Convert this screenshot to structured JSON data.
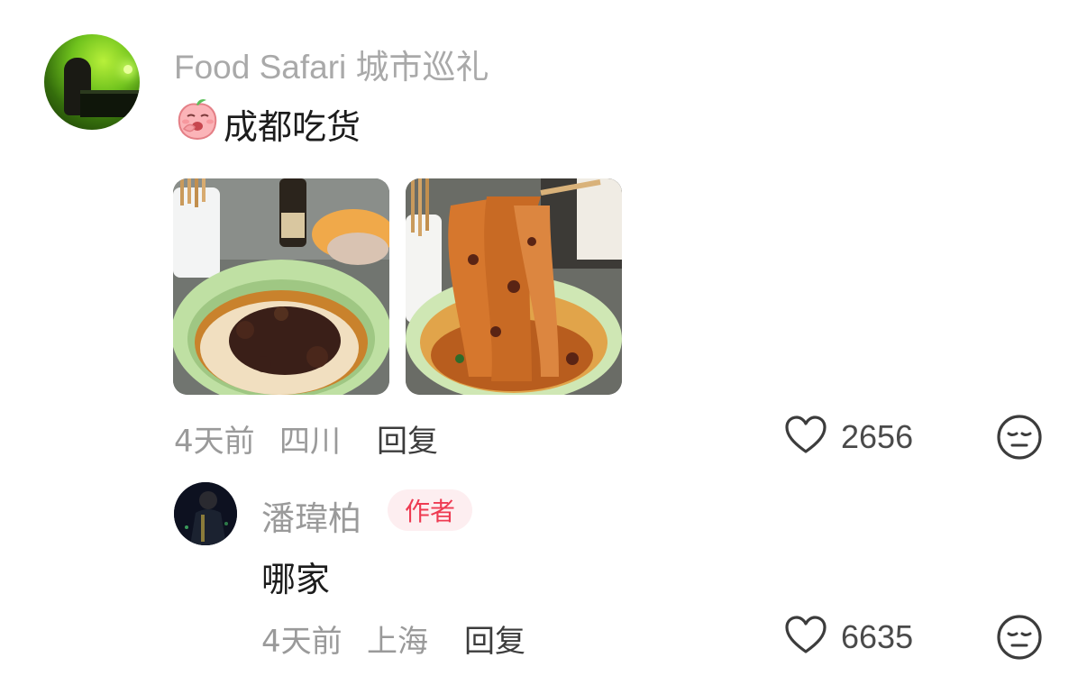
{
  "comment": {
    "username": "Food Safari 城市巡礼",
    "emoji": "peach-face-emoji",
    "text": "成都吃货",
    "time": "4天前",
    "location": "四川",
    "reply_label": "回复",
    "like_count": "2656",
    "images": [
      "noodle-bowl-photo",
      "noodle-lift-photo"
    ]
  },
  "reply": {
    "username": "潘瑋柏",
    "badge": "作者",
    "text": "哪家",
    "time": "4天前",
    "location": "上海",
    "reply_label": "回复",
    "like_count": "6635"
  },
  "colors": {
    "badge_bg": "#fdeef0",
    "badge_text": "#ee3b52",
    "meta_text": "#9a9a9a",
    "body_text": "#1c1c1c"
  }
}
